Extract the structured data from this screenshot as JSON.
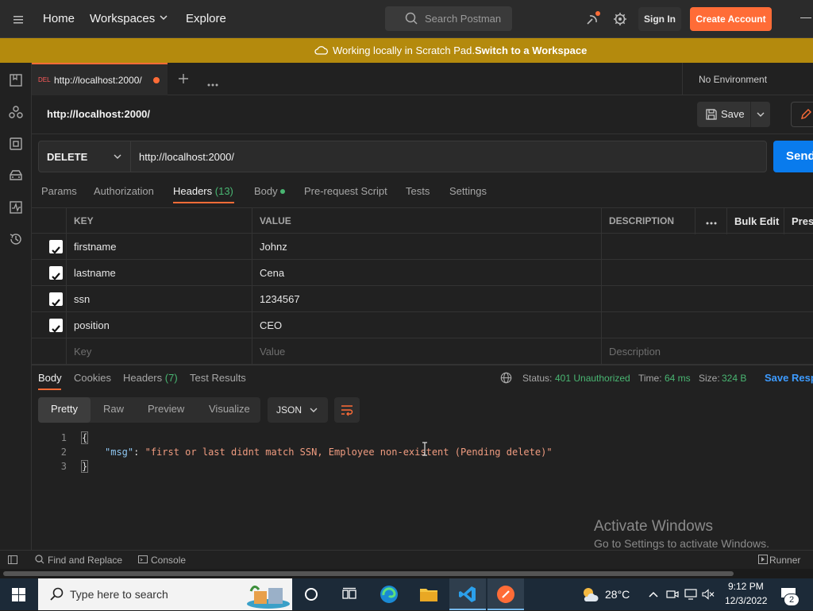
{
  "topbar": {
    "home": "Home",
    "workspaces": "Workspaces",
    "explore": "Explore",
    "search_placeholder": "Search Postman",
    "sign_in": "Sign In",
    "create_account": "Create Account"
  },
  "banner": {
    "text": "Working locally in Scratch Pad.",
    "link": "Switch to a Workspace"
  },
  "tab": {
    "method_badge": "DEL",
    "title": "http://localhost:2000/"
  },
  "environment": "No Environment",
  "request": {
    "name": "http://localhost:2000/",
    "save_label": "Save",
    "method": "DELETE",
    "url": "http://localhost:2000/",
    "send_label": "Send"
  },
  "request_tabs": {
    "params": "Params",
    "authorization": "Authorization",
    "headers": "Headers",
    "headers_count": "(13)",
    "body": "Body",
    "prerequest": "Pre-request Script",
    "tests": "Tests",
    "settings": "Settings"
  },
  "headers_table": {
    "col_key": "KEY",
    "col_value": "VALUE",
    "col_description": "DESCRIPTION",
    "bulk_edit": "Bulk Edit",
    "presets": "Prese",
    "rows": [
      {
        "key": "firstname",
        "value": "Johnz"
      },
      {
        "key": "lastname",
        "value": "Cena"
      },
      {
        "key": "ssn",
        "value": "1234567"
      },
      {
        "key": "position",
        "value": "CEO"
      }
    ],
    "placeholder_key": "Key",
    "placeholder_value": "Value",
    "placeholder_description": "Description"
  },
  "response": {
    "tabs": {
      "body": "Body",
      "cookies": "Cookies",
      "headers": "Headers",
      "headers_count": "(7)",
      "test_results": "Test Results"
    },
    "status_label": "Status:",
    "status_value": "401 Unauthorized",
    "time_label": "Time:",
    "time_value": "64 ms",
    "size_label": "Size:",
    "size_value": "324 B",
    "save_response": "Save Resp",
    "modes": [
      "Pretty",
      "Raw",
      "Preview",
      "Visualize"
    ],
    "format": "JSON",
    "lines": [
      "1",
      "2",
      "3"
    ],
    "code_open": "{",
    "code_key": "\"msg\"",
    "code_colon": ":",
    "code_value": "\"first or last didnt match SSN, Employee non-existent (Pending delete)\"",
    "code_close": "}"
  },
  "watermark": {
    "title": "Activate Windows",
    "subtitle": "Go to Settings to activate Windows."
  },
  "statusbar": {
    "find_replace": "Find and Replace",
    "console": "Console",
    "runner": "Runner"
  },
  "taskbar": {
    "search_placeholder": "Type here to search",
    "temperature": "28°C",
    "time": "9:12 PM",
    "date": "12/3/2022",
    "notifications": "2"
  },
  "colors": {
    "accent": "#ff6c37",
    "send_blue": "#097bed",
    "banner": "#b48a0d",
    "status_green": "#49b672"
  }
}
